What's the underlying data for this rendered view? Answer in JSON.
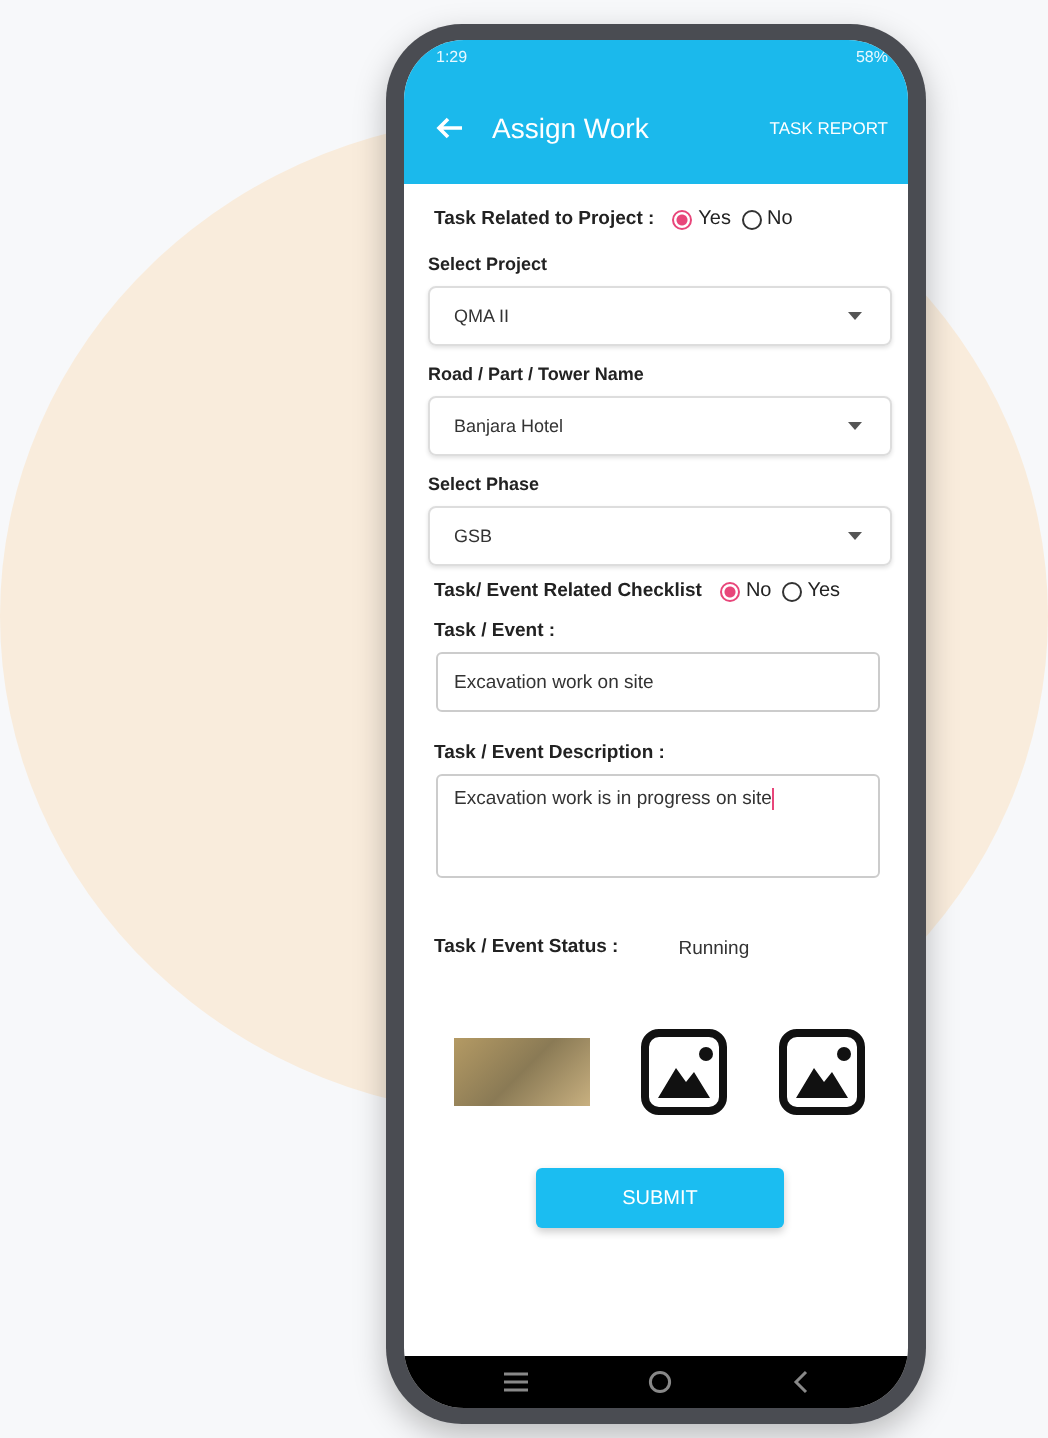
{
  "status_bar": {
    "time": "1:29",
    "battery": "58%"
  },
  "app_bar": {
    "title": "Assign Work",
    "action": "TASK REPORT"
  },
  "fields": [
    {
      "kind": "radio",
      "label": "Task Related to Project :",
      "options": [
        {
          "label": "Yes",
          "selected": true
        },
        {
          "label": "No",
          "selected": false
        }
      ]
    },
    {
      "kind": "dropdown",
      "label": "Select Project",
      "value": "QMA II"
    },
    {
      "kind": "dropdown",
      "label": "Road / Part / Tower Name",
      "value": "Banjara Hotel"
    },
    {
      "kind": "dropdown",
      "label": "Select Phase",
      "value": "GSB"
    },
    {
      "kind": "radio",
      "label": "Task/ Event Related Checklist",
      "options": [
        {
          "label": "No",
          "selected": true
        },
        {
          "label": "Yes",
          "selected": false
        }
      ]
    },
    {
      "kind": "text",
      "label": "Task / Event :",
      "value": "Excavation work on site"
    },
    {
      "kind": "textarea",
      "label": "Task / Event Description :",
      "value": "Excavation work is in progress on site"
    },
    {
      "kind": "status",
      "label": "Task / Event Status :",
      "value": "Running"
    }
  ],
  "attachments": [
    {
      "kind": "photo"
    },
    {
      "kind": "empty"
    },
    {
      "kind": "empty"
    }
  ],
  "submit": "SUBMIT"
}
